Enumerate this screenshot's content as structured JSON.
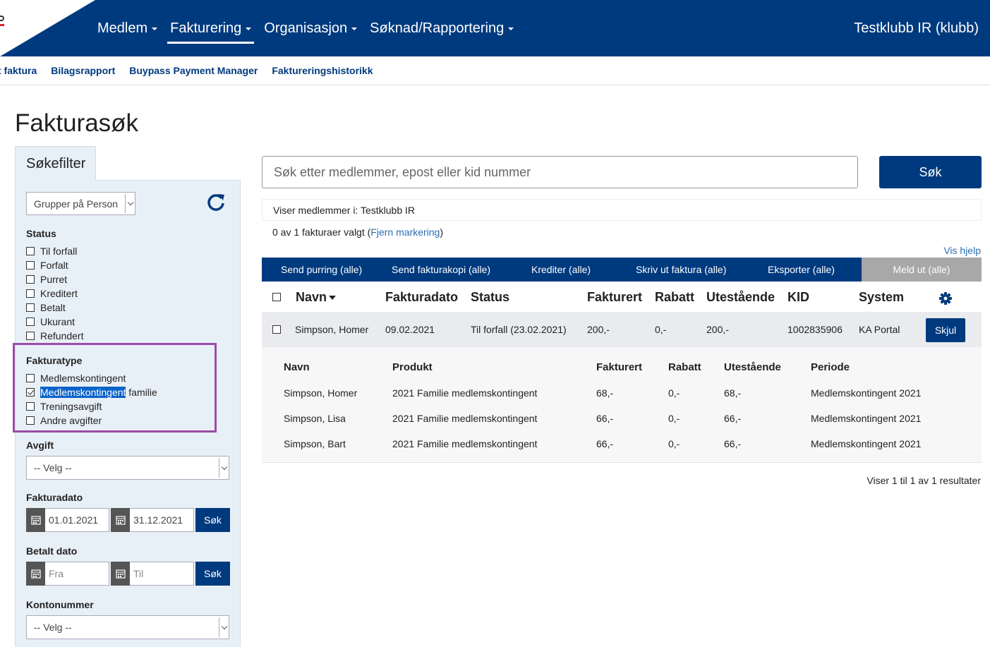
{
  "header": {
    "nav": [
      "Medlem",
      "Fakturering",
      "Organisasjon",
      "Søknad/Rapportering"
    ],
    "active_index": 1,
    "club": "Testklubb IR (klubb)"
  },
  "subnav": [
    "t faktura",
    "Bilagsrapport",
    "Buypass Payment Manager",
    "Faktureringshistorikk"
  ],
  "page_title": "Fakturasøk",
  "filter": {
    "tab_label": "Søkefilter",
    "group_select": "Grupper på Person",
    "status_label": "Status",
    "status_items": [
      "Til forfall",
      "Forfalt",
      "Purret",
      "Kreditert",
      "Betalt",
      "Ukurant",
      "Refundert"
    ],
    "type_label": "Fakturatype",
    "type_items": [
      {
        "before": "",
        "selected": "",
        "after": "Medlemskontingent",
        "checked": false
      },
      {
        "before": "",
        "selected": "Medlemskontingent",
        "after": " familie",
        "checked": true
      },
      {
        "before": "",
        "selected": "",
        "after": "Treningsavgift",
        "checked": false
      },
      {
        "before": "",
        "selected": "",
        "after": "Andre avgifter",
        "checked": false
      }
    ],
    "avgift_label": "Avgift",
    "avgift_select": "-- Velg --",
    "fakturadato_label": "Fakturadato",
    "date_from": "01.01.2021",
    "date_to": "31.12.2021",
    "sok": "Søk",
    "betalt_label": "Betalt dato",
    "betalt_from_ph": "Fra",
    "betalt_to_ph": "Til",
    "konto_label": "Kontonummer",
    "konto_select": "-- Velg --"
  },
  "search": {
    "placeholder": "Søk etter medlemmer, epost eller kid nummer",
    "button": "Søk"
  },
  "scope_text": "Viser medlemmer i: Testklubb IR",
  "selection": {
    "prefix": "0 av 1 fakturaer valgt (",
    "link": "Fjern markering",
    "suffix": ")"
  },
  "help": "Vis hjelp",
  "actions": [
    "Send purring (alle)",
    "Send fakturakopi (alle)",
    "Krediter (alle)",
    "Skriv ut faktura (alle)",
    "Eksporter (alle)"
  ],
  "action_disabled": "Meld ut (alle)",
  "table": {
    "columns": [
      "Navn",
      "Fakturadato",
      "Status",
      "Fakturert",
      "Rabatt",
      "Utestående",
      "KID",
      "System"
    ],
    "row": {
      "navn": "Simpson, Homer",
      "dato": "09.02.2021",
      "status": "Til forfall (23.02.2021)",
      "fakturert": "200,-",
      "rabatt": "0,-",
      "utestaende": "200,-",
      "kid": "1002835906",
      "system": "KA Portal",
      "button": "Skjul"
    }
  },
  "detail": {
    "columns": [
      "Navn",
      "Produkt",
      "Fakturert",
      "Rabatt",
      "Utestående",
      "Periode"
    ],
    "rows": [
      [
        "Simpson, Homer",
        "2021 Familie medlemskontingent",
        "68,-",
        "0,-",
        "68,-",
        "Medlemskontingent 2021"
      ],
      [
        "Simpson, Lisa",
        "2021 Familie medlemskontingent",
        "66,-",
        "0,-",
        "66,-",
        "Medlemskontingent 2021"
      ],
      [
        "Simpson, Bart",
        "2021 Familie medlemskontingent",
        "66,-",
        "0,-",
        "66,-",
        "Medlemskontingent 2021"
      ]
    ]
  },
  "results_text": "Viser 1 til 1 av 1 resultater",
  "colors": {
    "primary": "#003a7e",
    "panel": "#e8f0f7",
    "highlight": "#9c4ca6",
    "link": "#2a6db3"
  }
}
